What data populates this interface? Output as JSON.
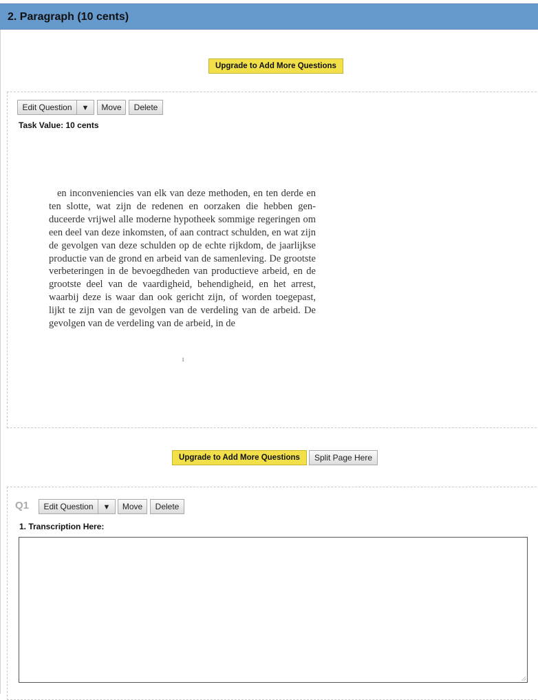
{
  "section": {
    "title": "2. Paragraph (10 cents)"
  },
  "top_upgrade": {
    "label": "Upgrade to Add More Questions"
  },
  "item1": {
    "edit_label": "Edit Question",
    "dropdown": "▼",
    "move_label": "Move",
    "delete_label": "Delete",
    "task_value": "Task Value: 10 cents",
    "document_text": "en inconveniencies van elk van deze methoden, en ten derde en ten slotte, wat zijn de redenen en oorzaken die hebben gen­duceerde vrijwel alle moderne hypotheek sommige regeringen om een deel van deze inkomsten, of aan contract schulden, en wat zijn de gevolgen van deze schulden op de echte rijkdom, de jaarlijkse productie van de grond en arbeid van de samenleving. De grootste verbeteringen in de bevoegdheden van productieve arbeid, en de grootste deel van de vaardigheid, behendigheid, en het arrest, waarbij deze is waar dan ook gericht zijn, of wor­den toegepast, lijkt te zijn van de gevolgen van de verdeling van de arbeid. De gevolgen van de verdeling van de arbeid, in de",
    "page_mark": "1"
  },
  "middle_actions": {
    "upgrade_label": "Upgrade to Add More Questions",
    "split_label": "Split Page Here"
  },
  "question1": {
    "number": "Q1",
    "edit_label": "Edit Question",
    "dropdown": "▼",
    "move_label": "Move",
    "delete_label": "Delete",
    "title": "1. Transcription Here:",
    "answer_value": ""
  }
}
